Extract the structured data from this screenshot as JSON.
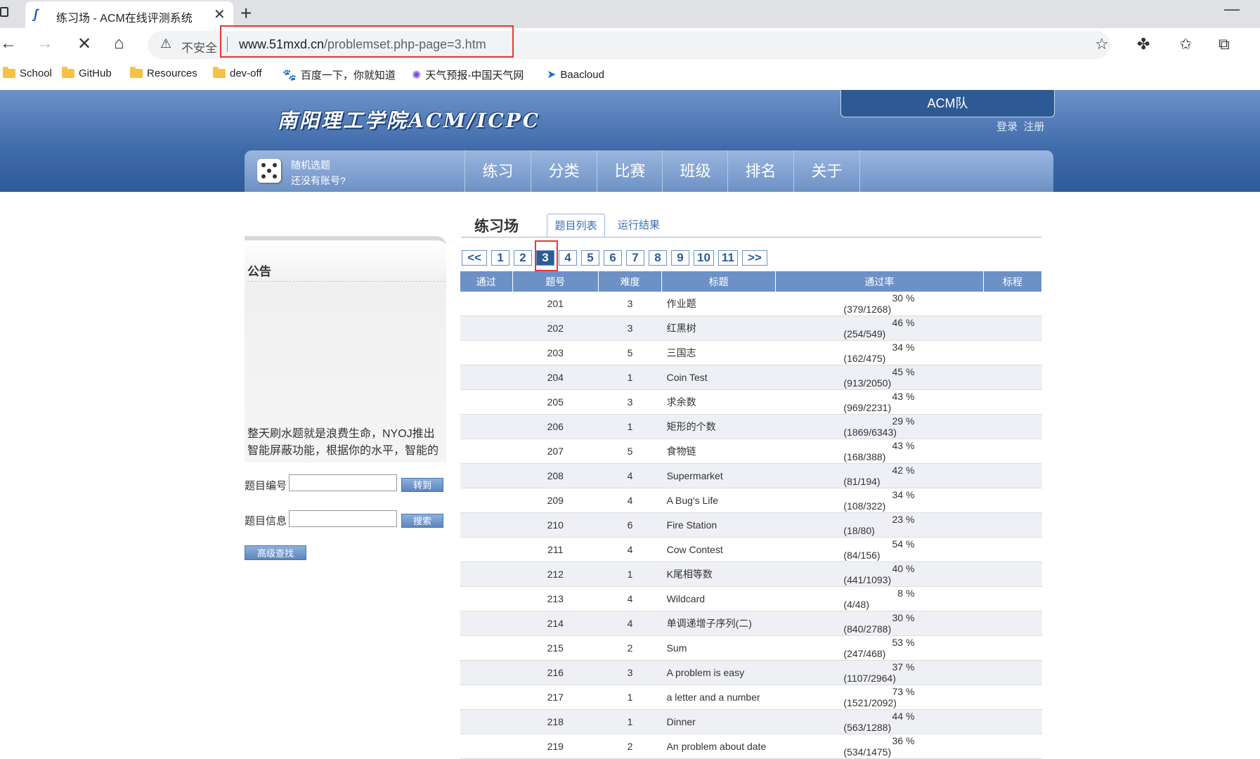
{
  "browser": {
    "tab_title": "练习场 - ACM在线评测系统",
    "security_label": "不安全",
    "url_host": "www.51mxd.cn",
    "url_path": "/problemset.php-page=3.htm"
  },
  "bookmarks": [
    {
      "label": "School",
      "icon": "folder-icon"
    },
    {
      "label": "GitHub",
      "icon": "folder-icon"
    },
    {
      "label": "Resources",
      "icon": "folder-icon"
    },
    {
      "label": "dev-off",
      "icon": "folder-icon"
    },
    {
      "label": "百度一下，你就知道",
      "icon": "baidu-paw-icon"
    },
    {
      "label": "天气预报-中国天气网",
      "icon": "weather-swirl-icon"
    },
    {
      "label": "Baacloud",
      "icon": "paper-plane-icon"
    }
  ],
  "site": {
    "logo_text": "南阳理工学院ACM/ICPC",
    "team_label": "ACM队",
    "login": "登录",
    "register": "注册",
    "random_problem": "随机选题",
    "no_account": "还没有账号?",
    "nav": [
      "练习",
      "分类",
      "比赛",
      "班级",
      "排名",
      "关于"
    ]
  },
  "sidebar": {
    "notice_title": "公告",
    "notice_text": "整天刷水题就是浪费生命，NYOJ推出智能屏蔽功能，根据你的水平，智能的为你",
    "problem_id_label": "题目编号",
    "goto_button": "转到",
    "problem_info_label": "题目信息",
    "search_button": "搜索",
    "advanced_search": "高级查找"
  },
  "main": {
    "title": "练习场",
    "tab_list": "题目列表",
    "tab_results": "运行结果",
    "pager": [
      "<<",
      "1",
      "2",
      "3",
      "4",
      "5",
      "6",
      "7",
      "8",
      "9",
      "10",
      "11",
      ">>"
    ],
    "current_page": "3",
    "columns": [
      "通过",
      "题号",
      "难度",
      "标题",
      "通过率",
      "标程"
    ],
    "rows": [
      {
        "id": "201",
        "difficulty": "3",
        "title": "作业题",
        "rate": "30 %",
        "count": "(379/1268)"
      },
      {
        "id": "202",
        "difficulty": "3",
        "title": "红黑树",
        "rate": "46 %",
        "count": "(254/549)"
      },
      {
        "id": "203",
        "difficulty": "5",
        "title": "三国志",
        "rate": "34 %",
        "count": "(162/475)"
      },
      {
        "id": "204",
        "difficulty": "1",
        "title": "Coin Test",
        "rate": "45 %",
        "count": "(913/2050)"
      },
      {
        "id": "205",
        "difficulty": "3",
        "title": "求余数",
        "rate": "43 %",
        "count": "(969/2231)"
      },
      {
        "id": "206",
        "difficulty": "1",
        "title": "矩形的个数",
        "rate": "29 %",
        "count": "(1869/6343)"
      },
      {
        "id": "207",
        "difficulty": "5",
        "title": "食物链",
        "rate": "43 %",
        "count": "(168/388)"
      },
      {
        "id": "208",
        "difficulty": "4",
        "title": "Supermarket",
        "rate": "42 %",
        "count": "(81/194)"
      },
      {
        "id": "209",
        "difficulty": "4",
        "title": "A Bug's Life",
        "rate": "34 %",
        "count": "(108/322)"
      },
      {
        "id": "210",
        "difficulty": "6",
        "title": "Fire Station",
        "rate": "23 %",
        "count": "(18/80)"
      },
      {
        "id": "211",
        "difficulty": "4",
        "title": "Cow Contest",
        "rate": "54 %",
        "count": "(84/156)"
      },
      {
        "id": "212",
        "difficulty": "1",
        "title": "K尾相等数",
        "rate": "40 %",
        "count": "(441/1093)"
      },
      {
        "id": "213",
        "difficulty": "4",
        "title": "Wildcard",
        "rate": "8 %",
        "count": "(4/48)"
      },
      {
        "id": "214",
        "difficulty": "4",
        "title": "单调递增子序列(二)",
        "rate": "30 %",
        "count": "(840/2788)"
      },
      {
        "id": "215",
        "difficulty": "2",
        "title": "Sum",
        "rate": "53 %",
        "count": "(247/468)"
      },
      {
        "id": "216",
        "difficulty": "3",
        "title": "A problem is easy",
        "rate": "37 %",
        "count": "(1107/2964)"
      },
      {
        "id": "217",
        "difficulty": "1",
        "title": "a letter and a number",
        "rate": "73 %",
        "count": "(1521/2092)"
      },
      {
        "id": "218",
        "difficulty": "1",
        "title": "Dinner",
        "rate": "44 %",
        "count": "(563/1288)"
      },
      {
        "id": "219",
        "difficulty": "2",
        "title": "An problem about date",
        "rate": "36 %",
        "count": "(534/1475)"
      }
    ]
  },
  "colors": {
    "header_blue": "#3d6aa8",
    "table_header": "#6d91c6",
    "link": "#3a6fb0",
    "highlight_red": "#e53935"
  }
}
